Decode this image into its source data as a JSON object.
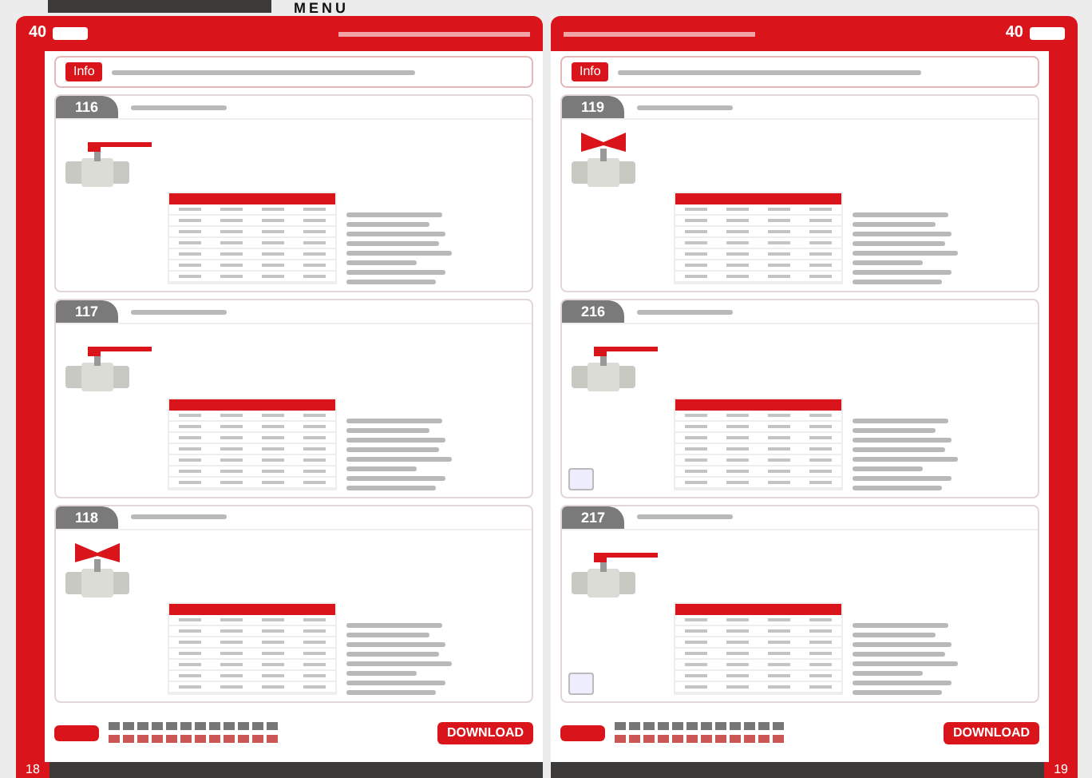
{
  "top_bar": {
    "label": "MENU"
  },
  "pages": [
    {
      "logo": "40",
      "info_tag": "Info",
      "download": "DOWNLOAD",
      "page_number": "18",
      "products": [
        {
          "number": "116",
          "kind": "lever",
          "certified": false
        },
        {
          "number": "117",
          "kind": "lever",
          "certified": false
        },
        {
          "number": "118",
          "kind": "butterfly",
          "certified": false
        }
      ]
    },
    {
      "logo": "40",
      "info_tag": "Info",
      "download": "DOWNLOAD",
      "page_number": "19",
      "products": [
        {
          "number": "119",
          "kind": "butterfly",
          "certified": false
        },
        {
          "number": "216",
          "kind": "lever",
          "certified": true
        },
        {
          "number": "217",
          "kind": "lever",
          "certified": true
        }
      ]
    }
  ]
}
